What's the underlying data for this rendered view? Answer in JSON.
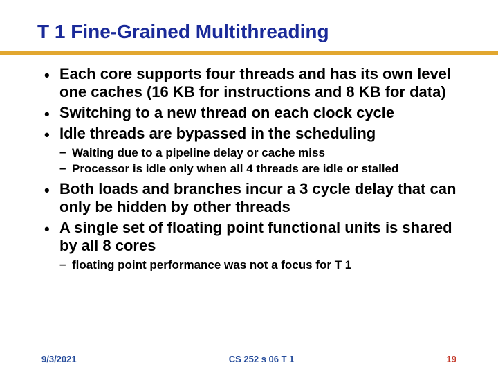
{
  "title": "T 1 Fine-Grained Multithreading",
  "bullets": {
    "b1": "Each core supports four threads and has its own level one caches (16 KB for instructions and 8 KB for data)",
    "b2": "Switching to a new thread on each clock cycle",
    "b3": "Idle threads are bypassed in the scheduling",
    "b3s1": "Waiting due to a pipeline delay or cache miss",
    "b3s2": "Processor is idle only when all 4 threads are idle or stalled",
    "b4": "Both loads and branches incur a 3 cycle delay that can only be hidden by other threads",
    "b5": "A single set of floating point functional units is shared by all 8 cores",
    "b5s1": " floating point performance was not a focus for T 1"
  },
  "footer": {
    "date": "9/3/2021",
    "course": "CS 252 s 06 T 1",
    "page": "19"
  },
  "colors": {
    "title": "#1a2a99",
    "rule": "#e2a72f",
    "footer_left": "#234a9a",
    "footer_right": "#c43a2b"
  }
}
